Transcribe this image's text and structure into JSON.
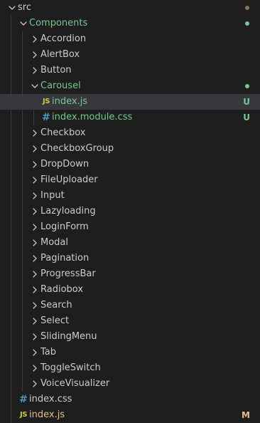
{
  "colors": {
    "untracked": "#73c991",
    "modified": "#e2c08d",
    "muted_dot": "#8b7355",
    "js_icon": "#cbcb41",
    "css_icon": "#519aba"
  },
  "tree": [
    {
      "label": "src",
      "kind": "folder",
      "depth": 0,
      "expanded": true,
      "status": "muted-dot"
    },
    {
      "label": "Components",
      "kind": "folder",
      "depth": 1,
      "expanded": true,
      "status": "untracked-dot"
    },
    {
      "label": "Accordion",
      "kind": "folder",
      "depth": 2,
      "expanded": false
    },
    {
      "label": "AlertBox",
      "kind": "folder",
      "depth": 2,
      "expanded": false
    },
    {
      "label": "Button",
      "kind": "folder",
      "depth": 2,
      "expanded": false
    },
    {
      "label": "Carousel",
      "kind": "folder",
      "depth": 2,
      "expanded": true,
      "status": "untracked-dot"
    },
    {
      "label": "index.js",
      "kind": "file",
      "icon": "js",
      "depth": 3,
      "status": "untracked",
      "badge": "U",
      "selected": true
    },
    {
      "label": "index.module.css",
      "kind": "file",
      "icon": "css",
      "depth": 3,
      "status": "untracked",
      "badge": "U"
    },
    {
      "label": "Checkbox",
      "kind": "folder",
      "depth": 2,
      "expanded": false
    },
    {
      "label": "CheckboxGroup",
      "kind": "folder",
      "depth": 2,
      "expanded": false
    },
    {
      "label": "DropDown",
      "kind": "folder",
      "depth": 2,
      "expanded": false
    },
    {
      "label": "FileUploader",
      "kind": "folder",
      "depth": 2,
      "expanded": false
    },
    {
      "label": "Input",
      "kind": "folder",
      "depth": 2,
      "expanded": false
    },
    {
      "label": "Lazyloading",
      "kind": "folder",
      "depth": 2,
      "expanded": false
    },
    {
      "label": "LoginForm",
      "kind": "folder",
      "depth": 2,
      "expanded": false
    },
    {
      "label": "Modal",
      "kind": "folder",
      "depth": 2,
      "expanded": false
    },
    {
      "label": "Pagination",
      "kind": "folder",
      "depth": 2,
      "expanded": false
    },
    {
      "label": "ProgressBar",
      "kind": "folder",
      "depth": 2,
      "expanded": false
    },
    {
      "label": "Radiobox",
      "kind": "folder",
      "depth": 2,
      "expanded": false
    },
    {
      "label": "Search",
      "kind": "folder",
      "depth": 2,
      "expanded": false
    },
    {
      "label": "Select",
      "kind": "folder",
      "depth": 2,
      "expanded": false
    },
    {
      "label": "SlidingMenu",
      "kind": "folder",
      "depth": 2,
      "expanded": false
    },
    {
      "label": "Tab",
      "kind": "folder",
      "depth": 2,
      "expanded": false
    },
    {
      "label": "ToggleSwitch",
      "kind": "folder",
      "depth": 2,
      "expanded": false
    },
    {
      "label": "VoiceVisualizer",
      "kind": "folder",
      "depth": 2,
      "expanded": false
    },
    {
      "label": "index.css",
      "kind": "file",
      "icon": "css",
      "depth": 1
    },
    {
      "label": "index.js",
      "kind": "file",
      "icon": "js",
      "depth": 1,
      "status": "modified",
      "badge": "M"
    }
  ]
}
